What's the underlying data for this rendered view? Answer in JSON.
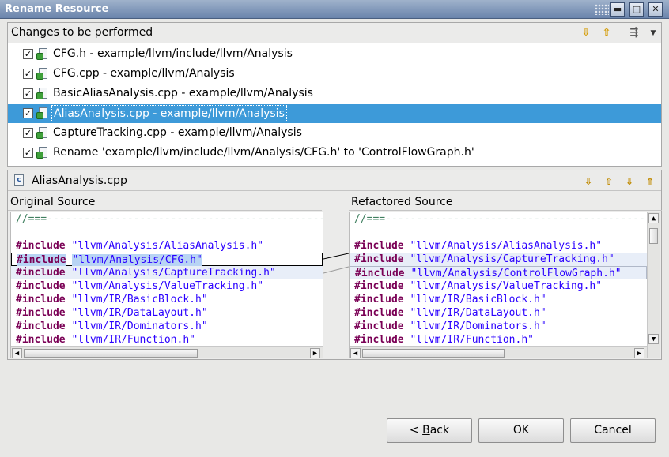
{
  "window": {
    "title": "Rename Resource",
    "controls": [
      "restore-icon",
      "maximize-icon",
      "close-icon"
    ]
  },
  "changes": {
    "header": "Changes to be performed",
    "toolbar_icons": [
      "down-arrow-icon",
      "up-arrow-icon",
      "filter-icon",
      "menu-dropdown-icon"
    ],
    "items": [
      {
        "label": "CFG.h - example/llvm/include/llvm/Analysis",
        "checked": true,
        "icon": "file-change-icon"
      },
      {
        "label": "CFG.cpp - example/llvm/Analysis",
        "checked": true,
        "icon": "file-change-icon"
      },
      {
        "label": "BasicAliasAnalysis.cpp - example/llvm/Analysis",
        "checked": true,
        "icon": "file-change-icon"
      },
      {
        "label": "AliasAnalysis.cpp - example/llvm/Analysis",
        "checked": true,
        "icon": "file-change-icon",
        "selected": true
      },
      {
        "label": "CaptureTracking.cpp - example/llvm/Analysis",
        "checked": true,
        "icon": "file-change-icon"
      },
      {
        "label": "Rename 'example/llvm/include/llvm/Analysis/CFG.h' to 'ControlFlowGraph.h'",
        "checked": true,
        "icon": "rename-icon"
      }
    ]
  },
  "compare": {
    "file": "AliasAnalysis.cpp",
    "nav_icons": [
      "next-difference-icon",
      "previous-difference-icon",
      "next-change-icon",
      "previous-change-icon"
    ],
    "left_header": "Original Source",
    "right_header": "Refactored Source",
    "left_lines": [
      {
        "kw": "",
        "str": "",
        "cmt": "//===----------------------------------------------------------------------===//"
      },
      {
        "kw": "",
        "str": "",
        "cmt": ""
      },
      {
        "kw": "#include",
        "str": "\"llvm/Analysis/AliasAnalysis.h\"",
        "cmt": ""
      },
      {
        "kw": "#include",
        "str": "\"llvm/Analysis/CFG.h\"",
        "cmt": ""
      },
      {
        "kw": "#include",
        "str": "\"llvm/Analysis/CaptureTracking.h\"",
        "cmt": ""
      },
      {
        "kw": "#include",
        "str": "\"llvm/Analysis/ValueTracking.h\"",
        "cmt": ""
      },
      {
        "kw": "#include",
        "str": "\"llvm/IR/BasicBlock.h\"",
        "cmt": ""
      },
      {
        "kw": "#include",
        "str": "\"llvm/IR/DataLayout.h\"",
        "cmt": ""
      },
      {
        "kw": "#include",
        "str": "\"llvm/IR/Dominators.h\"",
        "cmt": ""
      },
      {
        "kw": "#include",
        "str": "\"llvm/IR/Function.h\"",
        "cmt": ""
      }
    ],
    "right_lines": [
      {
        "kw": "",
        "str": "",
        "cmt": "//===----------------------------------------------------------------------===//"
      },
      {
        "kw": "",
        "str": "",
        "cmt": ""
      },
      {
        "kw": "#include",
        "str": "\"llvm/Analysis/AliasAnalysis.h\"",
        "cmt": ""
      },
      {
        "kw": "#include",
        "str": "\"llvm/Analysis/CaptureTracking.h\"",
        "cmt": ""
      },
      {
        "kw": "#include",
        "str": "\"llvm/Analysis/ControlFlowGraph.h\"",
        "cmt": ""
      },
      {
        "kw": "#include",
        "str": "\"llvm/Analysis/ValueTracking.h\"",
        "cmt": ""
      },
      {
        "kw": "#include",
        "str": "\"llvm/IR/BasicBlock.h\"",
        "cmt": ""
      },
      {
        "kw": "#include",
        "str": "\"llvm/IR/DataLayout.h\"",
        "cmt": ""
      },
      {
        "kw": "#include",
        "str": "\"llvm/IR/Dominators.h\"",
        "cmt": ""
      },
      {
        "kw": "#include",
        "str": "\"llvm/IR/Function.h\"",
        "cmt": ""
      }
    ]
  },
  "buttons": {
    "back_prefix": "< ",
    "back_mnemonic": "B",
    "back_rest": "ack",
    "ok": "OK",
    "cancel": "Cancel"
  },
  "colors": {
    "selection": "#3d9ad9",
    "keyword": "#7a0055",
    "string": "#2a00ff",
    "comment": "#3f7f5f"
  }
}
